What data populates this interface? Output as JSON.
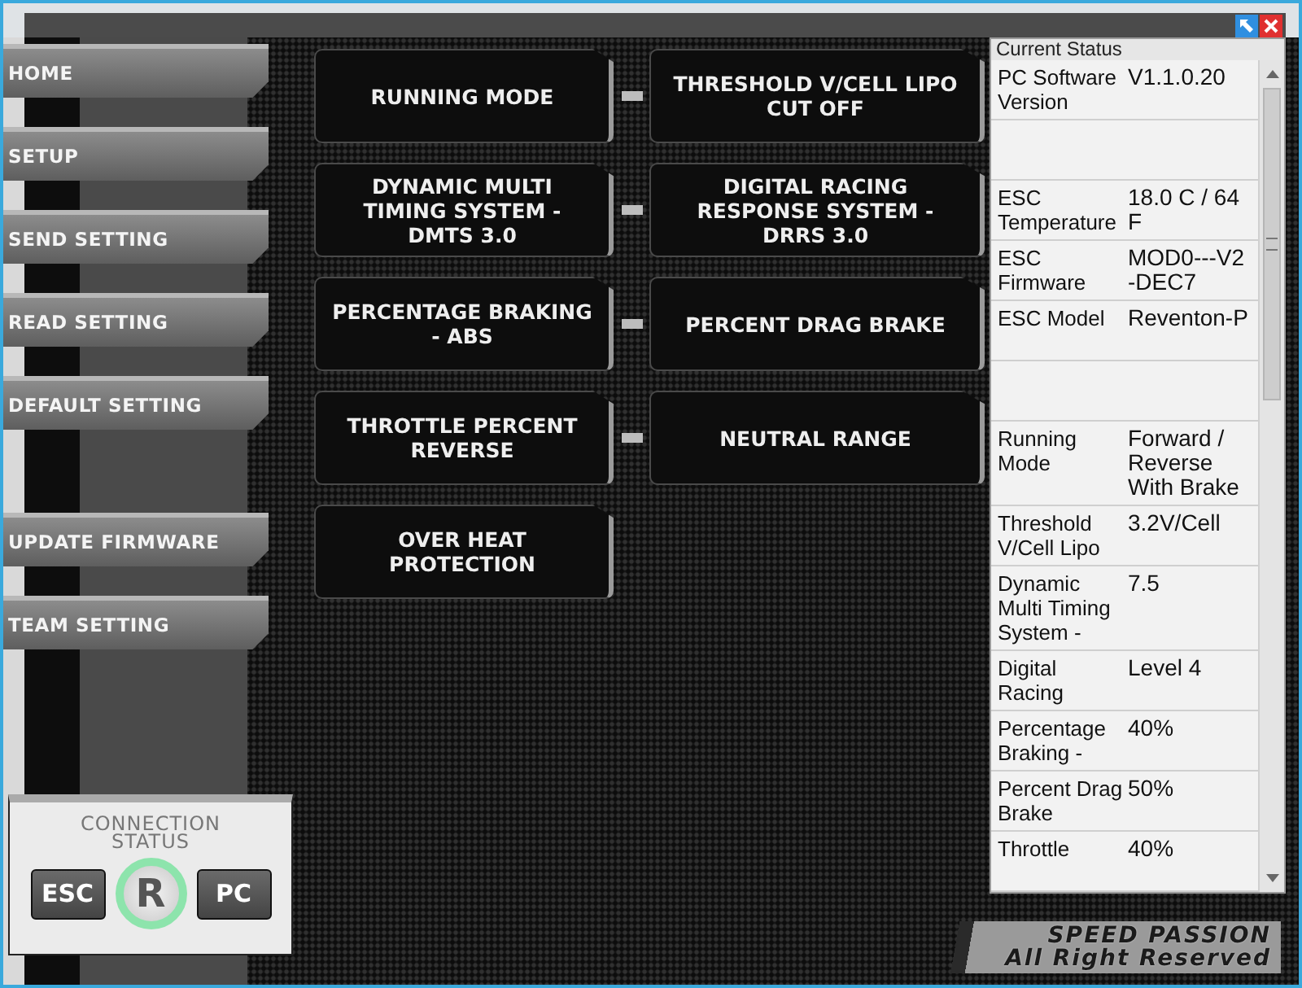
{
  "menu_groups": [
    [
      {
        "label": "HOME"
      },
      {
        "label": "SETUP"
      },
      {
        "label": "SEND SETTING"
      },
      {
        "label": "READ SETTING"
      },
      {
        "label": "DEFAULT SETTING"
      }
    ],
    [
      {
        "label": "UPDATE FIRMWARE"
      },
      {
        "label": "TEAM SETTING"
      }
    ]
  ],
  "tile_rows": [
    [
      "RUNNING MODE",
      "THRESHOLD V/CELL LIPO CUT OFF"
    ],
    [
      "DYNAMIC MULTI TIMING SYSTEM - DMTS 3.0",
      "DIGITAL RACING RESPONSE SYSTEM - DRRS 3.0"
    ],
    [
      "PERCENTAGE BRAKING - ABS",
      "PERCENT DRAG BRAKE"
    ],
    [
      "THROTTLE PERCENT REVERSE",
      "NEUTRAL RANGE"
    ],
    [
      "OVER HEAT PROTECTION"
    ]
  ],
  "connection_status": {
    "title": "CONNECTION STATUS",
    "left_button": "ESC",
    "logo": "R",
    "right_button": "PC"
  },
  "current_status": {
    "title": "Current Status",
    "rows": [
      {
        "kind": "entry",
        "label": "PC Software Version",
        "value": "V1.1.0.20"
      },
      {
        "kind": "blank"
      },
      {
        "kind": "entry",
        "label": "ESC Temperature",
        "value": "18.0 C / 64\nF"
      },
      {
        "kind": "entry",
        "label": "ESC Firmware",
        "value": "MOD0---V2\n-DEC7"
      },
      {
        "kind": "entry",
        "label": "ESC Model",
        "value": "Reventon-P"
      },
      {
        "kind": "blank"
      },
      {
        "kind": "entry",
        "label": "Running Mode",
        "value": "Forward /\nReverse\nWith Brake"
      },
      {
        "kind": "entry",
        "label": "Threshold V/Cell Lipo",
        "value": "3.2V/Cell"
      },
      {
        "kind": "entry",
        "label": "Dynamic Multi Timing System -",
        "value": "7.5"
      },
      {
        "kind": "entry",
        "label": "Digital Racing",
        "value": "Level 4"
      },
      {
        "kind": "entry",
        "label": "Percentage Braking -",
        "value": "40%"
      },
      {
        "kind": "entry",
        "label": "Percent Drag Brake",
        "value": "50%"
      },
      {
        "kind": "entry",
        "label": "Throttle",
        "value": "40%"
      }
    ]
  },
  "footer": {
    "brand": "SPEED PASSION",
    "rights": "All Right Reserved"
  }
}
